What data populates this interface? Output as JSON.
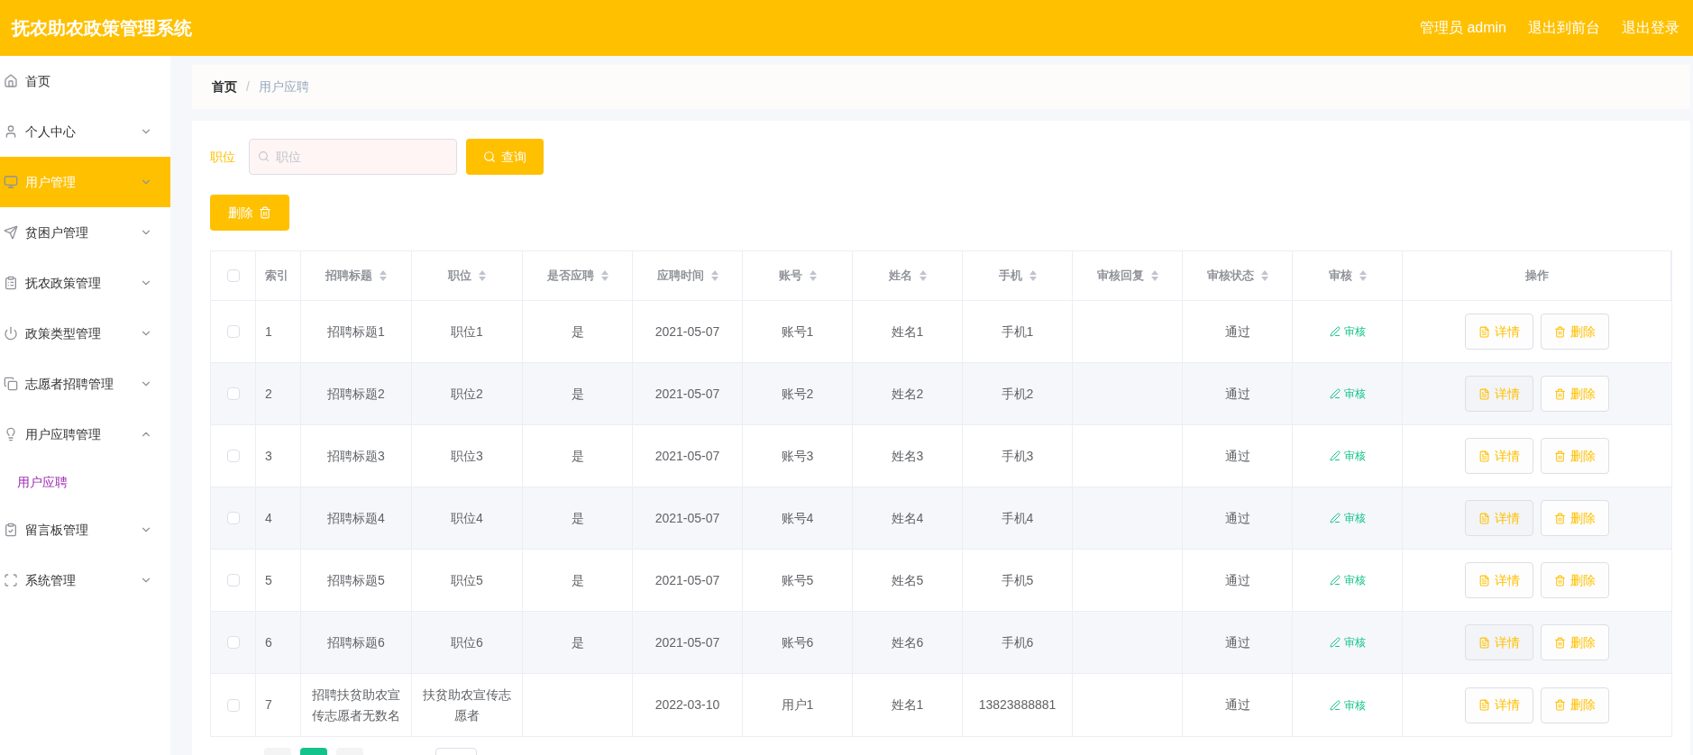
{
  "header": {
    "title": "抚农助农政策管理系统",
    "user_label": "管理员 admin",
    "links": [
      "退出到前台",
      "退出登录"
    ]
  },
  "sidebar": {
    "items": [
      {
        "label": "首页",
        "selected": false
      },
      {
        "label": "个人中心",
        "selected": false,
        "expanded": false
      },
      {
        "label": "用户管理",
        "selected": true,
        "expanded": false
      },
      {
        "label": "贫困户管理",
        "selected": false,
        "expanded": false
      },
      {
        "label": "抚农政策管理",
        "selected": false,
        "expanded": false
      },
      {
        "label": "政策类型管理",
        "selected": false,
        "expanded": false
      },
      {
        "label": "志愿者招聘管理",
        "selected": false,
        "expanded": false
      },
      {
        "label": "用户应聘管理",
        "selected": false,
        "expanded": true,
        "children": [
          {
            "label": "用户应聘",
            "selected": true
          }
        ]
      },
      {
        "label": "留言板管理",
        "selected": false,
        "expanded": false
      },
      {
        "label": "系统管理",
        "selected": false,
        "expanded": false
      }
    ]
  },
  "breadcrumb": {
    "separator": "/",
    "items": [
      "首页",
      "用户应聘"
    ]
  },
  "search": {
    "label": "职位",
    "placeholder": "职位",
    "button": "查询"
  },
  "delete_button": "删除",
  "table": {
    "select_all_checked": false,
    "columns": [
      {
        "label": "索引",
        "sortable": false
      },
      {
        "label": "招聘标题",
        "sortable": true
      },
      {
        "label": "职位",
        "sortable": true
      },
      {
        "label": "是否应聘",
        "sortable": true
      },
      {
        "label": "应聘时间",
        "sortable": true
      },
      {
        "label": "账号",
        "sortable": true
      },
      {
        "label": "姓名",
        "sortable": true
      },
      {
        "label": "手机",
        "sortable": true
      },
      {
        "label": "审核回复",
        "sortable": true
      },
      {
        "label": "审核状态",
        "sortable": true
      },
      {
        "label": "审核",
        "sortable": true
      },
      {
        "label": "操作",
        "sortable": false
      }
    ],
    "rows": [
      {
        "checked": false,
        "cells": [
          "1",
          "招聘标题1",
          "职位1",
          "是",
          "2021-05-07",
          "账号1",
          "姓名1",
          "手机1",
          "",
          "通过"
        ],
        "review": "审核",
        "actions": [
          "详情",
          "删除"
        ]
      },
      {
        "checked": false,
        "cells": [
          "2",
          "招聘标题2",
          "职位2",
          "是",
          "2021-05-07",
          "账号2",
          "姓名2",
          "手机2",
          "",
          "通过"
        ],
        "review": "审核",
        "actions": [
          "详情",
          "删除"
        ]
      },
      {
        "checked": false,
        "cells": [
          "3",
          "招聘标题3",
          "职位3",
          "是",
          "2021-05-07",
          "账号3",
          "姓名3",
          "手机3",
          "",
          "通过"
        ],
        "review": "审核",
        "actions": [
          "详情",
          "删除"
        ]
      },
      {
        "checked": false,
        "cells": [
          "4",
          "招聘标题4",
          "职位4",
          "是",
          "2021-05-07",
          "账号4",
          "姓名4",
          "手机4",
          "",
          "通过"
        ],
        "review": "审核",
        "actions": [
          "详情",
          "删除"
        ]
      },
      {
        "checked": false,
        "cells": [
          "5",
          "招聘标题5",
          "职位5",
          "是",
          "2021-05-07",
          "账号5",
          "姓名5",
          "手机5",
          "",
          "通过"
        ],
        "review": "审核",
        "actions": [
          "详情",
          "删除"
        ]
      },
      {
        "checked": false,
        "cells": [
          "6",
          "招聘标题6",
          "职位6",
          "是",
          "2021-05-07",
          "账号6",
          "姓名6",
          "手机6",
          "",
          "通过"
        ],
        "review": "审核",
        "actions": [
          "详情",
          "删除"
        ]
      },
      {
        "checked": false,
        "cells": [
          "7",
          "招聘扶贫助农宣传志愿者无数名",
          "扶贫助农宣传志愿者",
          "",
          "2022-03-10",
          "用户1",
          "姓名1",
          "13823888881",
          "",
          "通过"
        ],
        "review": "审核",
        "actions": [
          "详情",
          "删除"
        ]
      }
    ]
  }
}
